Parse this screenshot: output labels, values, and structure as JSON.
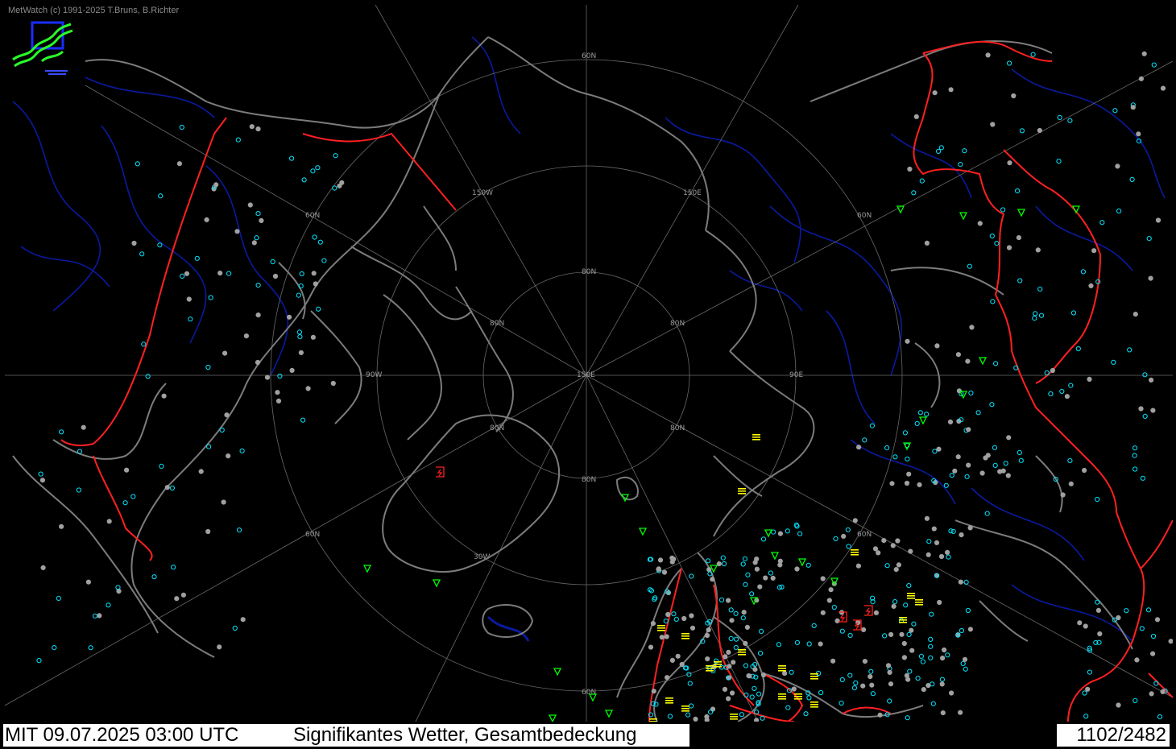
{
  "app": {
    "copyright": "MetWatch  (c) 1991-2025 T.Bruns, B.Richter"
  },
  "status_bar": {
    "time": "MIT 09.07.2025 03:00 UTC",
    "product": "Signifikantes Wetter, Gesamtbedeckung",
    "counter": "1102/2482"
  },
  "map": {
    "projection": "polar stereographic",
    "graticule_labels": {
      "lon": [
        "150W",
        "150E",
        "90W",
        "90E",
        "30W",
        "150E"
      ],
      "lat": [
        "60N",
        "80N"
      ]
    },
    "colors": {
      "background": "#000000",
      "coast": "#808080",
      "border": "#ff2020",
      "river": "#0a1aa0",
      "grid": "#707070",
      "cloud_symbol": "#00e5ff",
      "station_grey": "#a0a0a0",
      "fog": "#ffff00",
      "shower": "#00ff00"
    },
    "icons": [
      "metwatch-logo-icon",
      "station-cloud-cover-icon",
      "fog-symbol-icon",
      "shower-symbol-icon",
      "thunderstorm-symbol-icon"
    ]
  }
}
